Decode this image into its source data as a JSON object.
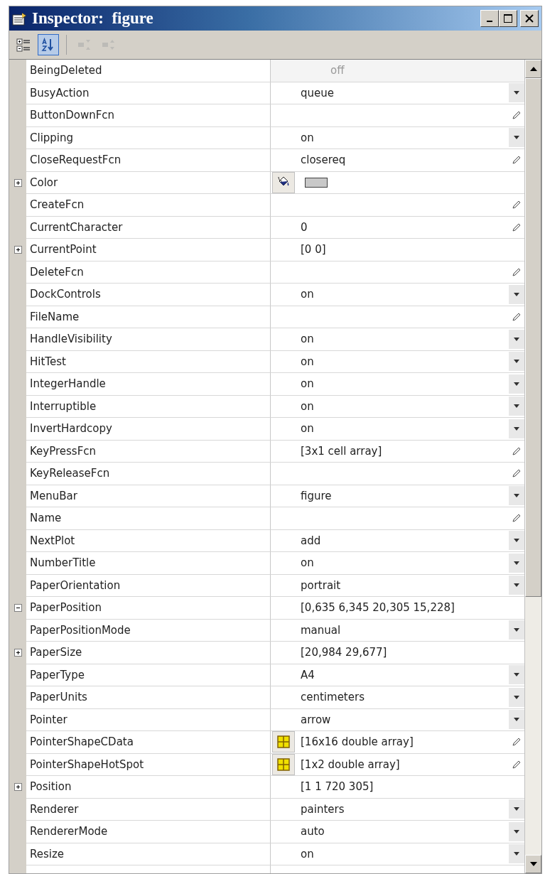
{
  "window": {
    "title": "Inspector:  figure"
  },
  "toolbar": [
    {
      "kind": "categorized",
      "selected": false,
      "disabled": false
    },
    {
      "kind": "alphabetical",
      "selected": true,
      "disabled": false
    },
    {
      "kind": "expand",
      "selected": false,
      "disabled": true
    },
    {
      "kind": "collapse",
      "selected": false,
      "disabled": true
    }
  ],
  "properties": [
    {
      "name": "BeingDeleted",
      "value": "off",
      "kind": "readonly",
      "disabled": true,
      "expandable": false
    },
    {
      "name": "BusyAction",
      "value": "queue",
      "kind": "choice",
      "disabled": false,
      "expandable": false
    },
    {
      "name": "ButtonDownFcn",
      "kind": "edit",
      "disabled": false,
      "expandable": false
    },
    {
      "name": "Clipping",
      "value": "on",
      "kind": "choice",
      "disabled": false,
      "expandable": false
    },
    {
      "name": "CloseRequestFcn",
      "value": "closereq",
      "kind": "edit",
      "disabled": false,
      "expandable": false
    },
    {
      "name": "Color",
      "kind": "color",
      "color": "#c8c8c8",
      "disabled": false,
      "expandable": true,
      "expanded": false
    },
    {
      "name": "CreateFcn",
      "kind": "edit",
      "disabled": false,
      "expandable": false
    },
    {
      "name": "CurrentCharacter",
      "value": "0",
      "kind": "edit",
      "disabled": false,
      "expandable": false
    },
    {
      "name": "CurrentPoint",
      "value": "[0 0]",
      "kind": "readonly",
      "disabled": false,
      "expandable": true,
      "expanded": false
    },
    {
      "name": "DeleteFcn",
      "kind": "edit",
      "disabled": false,
      "expandable": false
    },
    {
      "name": "DockControls",
      "value": "on",
      "kind": "choice",
      "disabled": false,
      "expandable": false
    },
    {
      "name": "FileName",
      "kind": "edit",
      "disabled": false,
      "expandable": false
    },
    {
      "name": "HandleVisibility",
      "value": "on",
      "kind": "choice",
      "disabled": false,
      "expandable": false
    },
    {
      "name": "HitTest",
      "value": "on",
      "kind": "choice",
      "disabled": false,
      "expandable": false
    },
    {
      "name": "IntegerHandle",
      "value": "on",
      "kind": "choice",
      "disabled": false,
      "expandable": false
    },
    {
      "name": "Interruptible",
      "value": "on",
      "kind": "choice",
      "disabled": false,
      "expandable": false
    },
    {
      "name": "InvertHardcopy",
      "value": "on",
      "kind": "choice",
      "disabled": false,
      "expandable": false
    },
    {
      "name": "KeyPressFcn",
      "value": "[3x1  cell array]",
      "kind": "edit",
      "disabled": false,
      "expandable": false
    },
    {
      "name": "KeyReleaseFcn",
      "kind": "edit",
      "disabled": false,
      "expandable": false
    },
    {
      "name": "MenuBar",
      "value": "figure",
      "kind": "choice",
      "disabled": false,
      "expandable": false
    },
    {
      "name": "Name",
      "kind": "edit",
      "disabled": false,
      "expandable": false
    },
    {
      "name": "NextPlot",
      "value": "add",
      "kind": "choice",
      "disabled": false,
      "expandable": false
    },
    {
      "name": "NumberTitle",
      "value": "on",
      "kind": "choice",
      "disabled": false,
      "expandable": false
    },
    {
      "name": "PaperOrientation",
      "value": "portrait",
      "kind": "choice",
      "disabled": false,
      "expandable": false
    },
    {
      "name": "PaperPosition",
      "value": "[0,635 6,345 20,305 15,228]",
      "kind": "readonly",
      "disabled": false,
      "expandable": true,
      "expanded": true
    },
    {
      "name": "PaperPositionMode",
      "value": "manual",
      "kind": "choice",
      "disabled": false,
      "expandable": false
    },
    {
      "name": "PaperSize",
      "value": "[20,984 29,677]",
      "kind": "readonly",
      "disabled": false,
      "expandable": true,
      "expanded": false
    },
    {
      "name": "PaperType",
      "value": "A4",
      "kind": "choice",
      "disabled": false,
      "expandable": false
    },
    {
      "name": "PaperUnits",
      "value": "centimeters",
      "kind": "choice",
      "disabled": false,
      "expandable": false
    },
    {
      "name": "Pointer",
      "value": "arrow",
      "kind": "choice",
      "disabled": false,
      "expandable": false
    },
    {
      "name": "PointerShapeCData",
      "value": "[16x16  double array]",
      "kind": "array",
      "disabled": false,
      "expandable": false
    },
    {
      "name": "PointerShapeHotSpot",
      "value": "[1x2  double array]",
      "kind": "array",
      "disabled": false,
      "expandable": false
    },
    {
      "name": "Position",
      "value": "[1 1 720 305]",
      "kind": "readonly",
      "disabled": false,
      "expandable": true,
      "expanded": false
    },
    {
      "name": "Renderer",
      "value": "painters",
      "kind": "choice",
      "disabled": false,
      "expandable": false
    },
    {
      "name": "RendererMode",
      "value": "auto",
      "kind": "choice",
      "disabled": false,
      "expandable": false
    },
    {
      "name": "Resize",
      "value": "on",
      "kind": "choice",
      "disabled": false,
      "expandable": false
    }
  ]
}
